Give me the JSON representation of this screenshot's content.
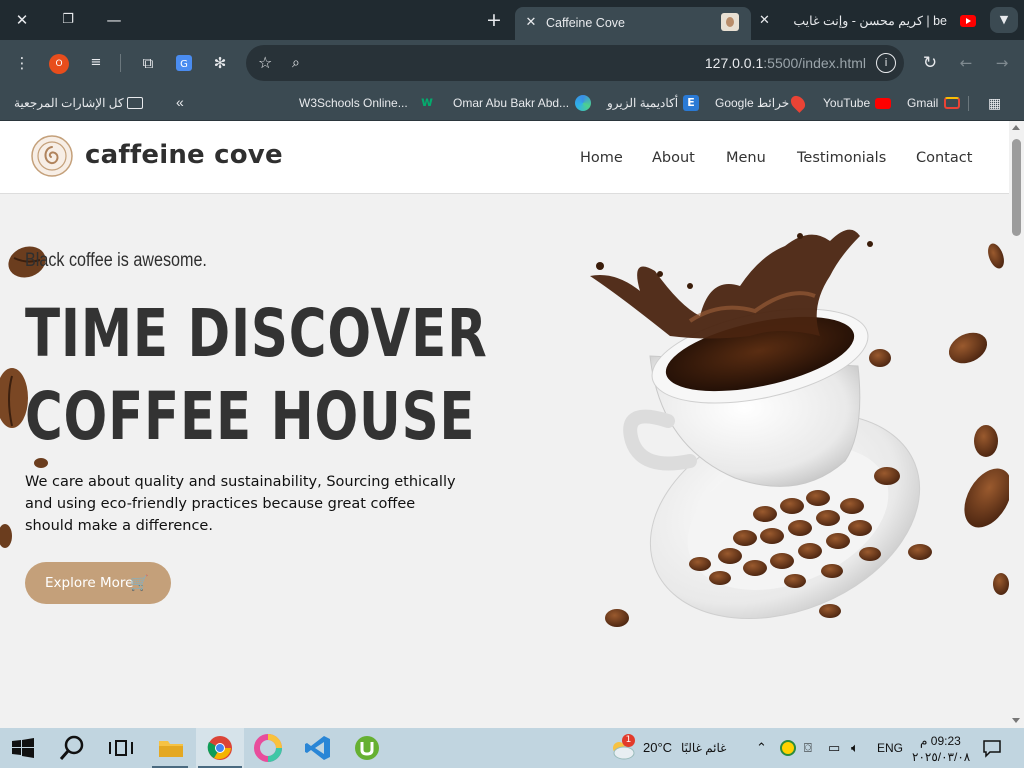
{
  "browser": {
    "tabs": [
      {
        "title": "Caffeine Cove",
        "active": true
      },
      {
        "title": "be | كريم محسن - وإنت غايب",
        "active": false
      }
    ],
    "url_host": "127.0.0.1",
    "url_rest": ":5500/index.html",
    "extension_badge": "O",
    "bookmarks": [
      {
        "label": "كل الإشارات المرجعية",
        "icon": "folder-icon"
      },
      {
        "label": "W3Schools Online...",
        "icon": "w3schools-icon"
      },
      {
        "label": "Omar Abu Bakr Abd...",
        "icon": "edge-icon"
      },
      {
        "label": "أكاديمية الزيرو",
        "icon": "zero-academy-icon"
      },
      {
        "label": "Google خرائط",
        "icon": "maps-icon"
      },
      {
        "label": "YouTube",
        "icon": "youtube-icon"
      },
      {
        "label": "Gmail",
        "icon": "gmail-icon"
      }
    ]
  },
  "site": {
    "name": "caffeine cove",
    "nav": [
      "Home",
      "About",
      "Menu",
      "Testimonials",
      "Contact"
    ],
    "tagline": "Black coffee is awesome.",
    "headline_1": "TIME DISCOVER",
    "headline_2": "COFFEE HOUSE",
    "intro": "We care about quality and sustainability, Sourcing ethically and using eco-friendly practices because great coffee should make a difference.",
    "cta": "Explore More",
    "colors": {
      "accent": "#c4a07a",
      "text": "#333333",
      "background": "#f1f1f1"
    }
  },
  "taskbar": {
    "weather_temp": "20°C",
    "weather_text": "غائم غالبًا",
    "weather_badge": "1",
    "language": "ENG",
    "time": "09:23 م",
    "date": "٢٠٢٥/٠٣/٠٨"
  }
}
